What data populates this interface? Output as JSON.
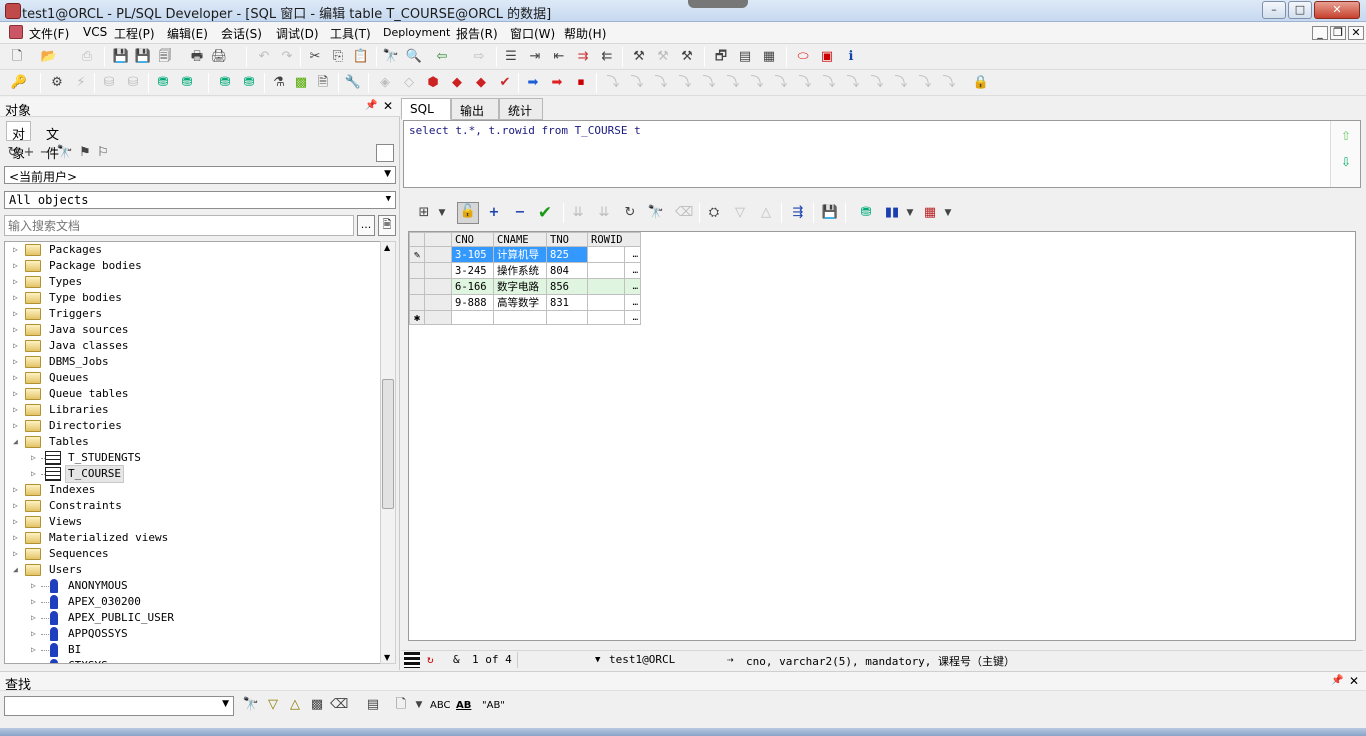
{
  "window": {
    "title": "test1@ORCL - PL/SQL Developer - [SQL 窗口 - 编辑 table T_COURSE@ORCL 的数据]",
    "min_label": "–",
    "max_label": "□",
    "close_label": "✕"
  },
  "menu": {
    "items": [
      "文件(F)",
      "VCS",
      "工程(P)",
      "编辑(E)",
      "会话(S)",
      "调试(D)",
      "工具(T)",
      "Deployment",
      "报告(R)",
      "窗口(W)",
      "帮助(H)"
    ],
    "mdi_min": "_",
    "mdi_restore": "❐",
    "mdi_close": "✕"
  },
  "left_panel": {
    "header": "对象",
    "pin": "📌",
    "close": "✕",
    "tabs": [
      "对象",
      "文件"
    ],
    "owner_combo": "<当前用户>",
    "filter_combo": "All objects",
    "search_placeholder": "输入搜索文档",
    "search_btn": "...",
    "tree": [
      {
        "label": "Packages",
        "type": "folder",
        "level": 0,
        "expanded": false
      },
      {
        "label": "Package bodies",
        "type": "folder",
        "level": 0,
        "expanded": false
      },
      {
        "label": "Types",
        "type": "folder",
        "level": 0,
        "expanded": false
      },
      {
        "label": "Type bodies",
        "type": "folder",
        "level": 0,
        "expanded": false
      },
      {
        "label": "Triggers",
        "type": "folder",
        "level": 0,
        "expanded": false
      },
      {
        "label": "Java sources",
        "type": "folder",
        "level": 0,
        "expanded": false
      },
      {
        "label": "Java classes",
        "type": "folder",
        "level": 0,
        "expanded": false
      },
      {
        "label": "DBMS_Jobs",
        "type": "folder",
        "level": 0,
        "expanded": false
      },
      {
        "label": "Queues",
        "type": "folder",
        "level": 0,
        "expanded": false
      },
      {
        "label": "Queue tables",
        "type": "folder",
        "level": 0,
        "expanded": false
      },
      {
        "label": "Libraries",
        "type": "folder",
        "level": 0,
        "expanded": false
      },
      {
        "label": "Directories",
        "type": "folder",
        "level": 0,
        "expanded": false
      },
      {
        "label": "Tables",
        "type": "folder",
        "level": 0,
        "expanded": true
      },
      {
        "label": "T_STUDENGTS",
        "type": "table",
        "level": 1,
        "expanded": false
      },
      {
        "label": "T_COURSE",
        "type": "table",
        "level": 1,
        "expanded": false,
        "selected": true
      },
      {
        "label": "Indexes",
        "type": "folder",
        "level": 0,
        "expanded": false
      },
      {
        "label": "Constraints",
        "type": "folder",
        "level": 0,
        "expanded": false
      },
      {
        "label": "Views",
        "type": "folder",
        "level": 0,
        "expanded": false
      },
      {
        "label": "Materialized views",
        "type": "folder",
        "level": 0,
        "expanded": false
      },
      {
        "label": "Sequences",
        "type": "folder",
        "level": 0,
        "expanded": false
      },
      {
        "label": "Users",
        "type": "folder",
        "level": 0,
        "expanded": true
      },
      {
        "label": "ANONYMOUS",
        "type": "user",
        "level": 1,
        "expanded": false
      },
      {
        "label": "APEX_030200",
        "type": "user",
        "level": 1,
        "expanded": false
      },
      {
        "label": "APEX_PUBLIC_USER",
        "type": "user",
        "level": 1,
        "expanded": false
      },
      {
        "label": "APPQOSSYS",
        "type": "user",
        "level": 1,
        "expanded": false
      },
      {
        "label": "BI",
        "type": "user",
        "level": 1,
        "expanded": false
      },
      {
        "label": "CTXSYS",
        "type": "user",
        "level": 1,
        "expanded": false
      }
    ]
  },
  "editor": {
    "tabs": [
      "SQL",
      "输出",
      "统计"
    ],
    "sql": "select t.*, t.rowid from T_COURSE t"
  },
  "grid": {
    "columns": [
      "CNO",
      "CNAME",
      "TNO",
      "ROWID"
    ],
    "rows": [
      {
        "CNO": "3-105",
        "CNAME": "计算机导",
        "TNO": "825",
        "ROWID": ""
      },
      {
        "CNO": "3-245",
        "CNAME": "操作系统",
        "TNO": "804",
        "ROWID": ""
      },
      {
        "CNO": "6-166",
        "CNAME": "数字电路",
        "TNO": "856",
        "ROWID": ""
      },
      {
        "CNO": "9-888",
        "CNAME": "高等数学",
        "TNO": "831",
        "ROWID": ""
      }
    ],
    "new_row_marker": "✱",
    "edit_marker": "✎",
    "cell_btn": "…"
  },
  "status": {
    "record": "1 of 4",
    "connection": "test1@ORCL",
    "field_info": "cno, varchar2(5), mandatory, 课程号（主键）"
  },
  "find": {
    "header": "查找",
    "pin": "📌",
    "close": "✕",
    "input_value": "",
    "abc": "ABC",
    "ab_quoted": "\"AB\""
  },
  "colors": {
    "selection": "#3399ff",
    "alt_row": "#dff5df",
    "sql_text": "#1a1a80"
  }
}
